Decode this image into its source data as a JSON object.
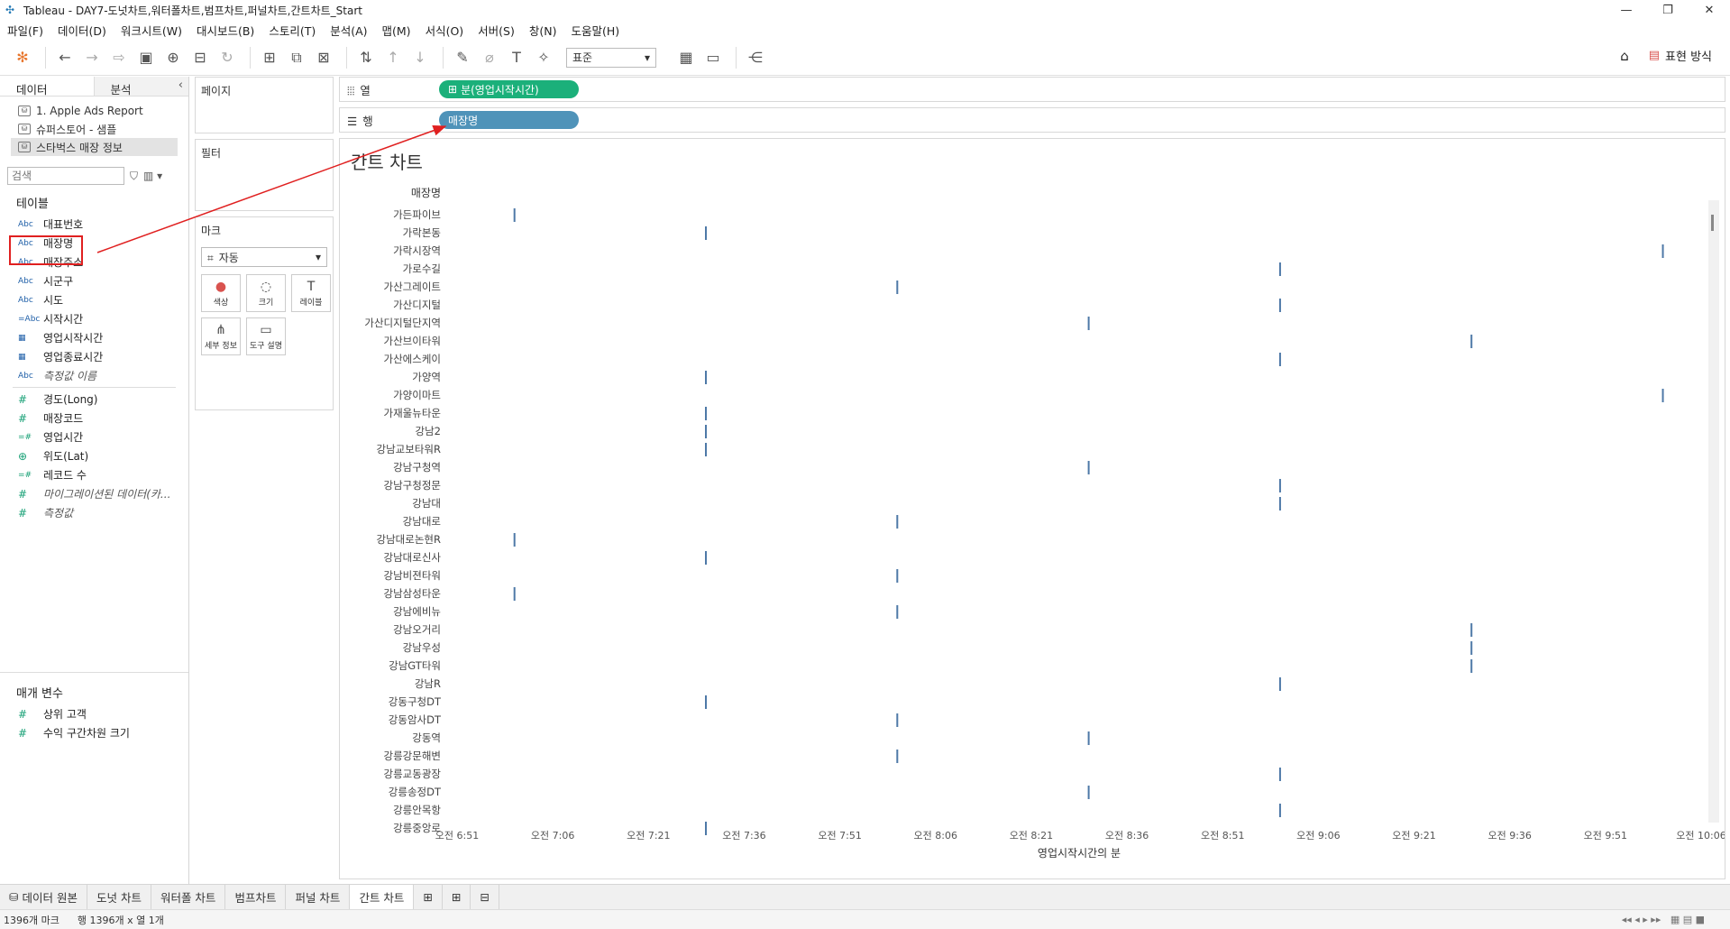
{
  "window": {
    "title": "Tableau - DAY7-도넛차트,워터폴차트,범프차트,퍼널차트,간트차트_Start"
  },
  "menu": [
    "파일(F)",
    "데이터(D)",
    "워크시트(W)",
    "대시보드(B)",
    "스토리(T)",
    "분석(A)",
    "맵(M)",
    "서식(O)",
    "서버(S)",
    "창(N)",
    "도움말(H)"
  ],
  "toolbar": {
    "fit_select": "표준",
    "show_me_label": "표현 방식"
  },
  "left_pane": {
    "tab_data": "데이터",
    "tab_analysis": "분석",
    "datasources": [
      "1. Apple Ads Report",
      "슈퍼스토어 - 샘플",
      "스타벅스 매장 정보"
    ],
    "search_placeholder": "검색",
    "tables_title": "테이블",
    "dimensions": [
      {
        "type": "Abc",
        "name": "대표번호"
      },
      {
        "type": "Abc",
        "name": "매장명"
      },
      {
        "type": "Abc",
        "name": "매장주소"
      },
      {
        "type": "Abc",
        "name": "시군구"
      },
      {
        "type": "Abc",
        "name": "시도"
      },
      {
        "type": "=Abc",
        "name": "시작시간"
      },
      {
        "type": "date",
        "name": "영업시작시간"
      },
      {
        "type": "date",
        "name": "영업종료시간"
      },
      {
        "type": "Abc",
        "name": "측정값 이름"
      }
    ],
    "measures": [
      {
        "type": "#",
        "name": "경도(Long)"
      },
      {
        "type": "#",
        "name": "매장코드"
      },
      {
        "type": "=#",
        "name": "영업시간"
      },
      {
        "type": "globe",
        "name": "위도(Lat)"
      },
      {
        "type": "=#",
        "name": "레코드 수"
      },
      {
        "type": "#",
        "name": "마이그레이션된 데이터(카..."
      },
      {
        "type": "#",
        "name": "측정값"
      }
    ],
    "params_title": "매개 변수",
    "params": [
      {
        "type": "#",
        "name": "상위 고객"
      },
      {
        "type": "#",
        "name": "수익 구간차원 크기"
      }
    ]
  },
  "cards": {
    "pages": "페이지",
    "filters": "필터",
    "marks": "마크",
    "marks_type": "자동",
    "mark_buttons": [
      {
        "icon": "color-icon",
        "label": "색상"
      },
      {
        "icon": "size-icon",
        "label": "크기"
      },
      {
        "icon": "label-icon",
        "label": "레이블"
      },
      {
        "icon": "detail-icon",
        "label": "세부 정보"
      },
      {
        "icon": "tooltip-icon",
        "label": "도구 설명"
      }
    ]
  },
  "shelves": {
    "columns_label": "열",
    "rows_label": "행",
    "columns_pill": "분(영업시작시간)",
    "rows_pill": "매장명"
  },
  "viz": {
    "title": "간트 차트"
  },
  "chart_data": {
    "type": "gantt",
    "title": "간트 차트",
    "row_header": "매장명",
    "xlabel": "영업시작시간의 분",
    "xticks": [
      "오전 6:51",
      "오전 7:06",
      "오전 7:21",
      "오전 7:36",
      "오전 7:51",
      "오전 8:06",
      "오전 8:21",
      "오전 8:36",
      "오전 8:51",
      "오전 9:06",
      "오전 9:21",
      "오전 9:36",
      "오전 9:51",
      "오전 10:06"
    ],
    "x_range_minutes": [
      411,
      606
    ],
    "stores": [
      {
        "name": "가든파이브",
        "start": "7:00"
      },
      {
        "name": "가락본동",
        "start": "7:30"
      },
      {
        "name": "가락시장역",
        "start": "10:00"
      },
      {
        "name": "가로수길",
        "start": "9:00"
      },
      {
        "name": "가산그레이트",
        "start": "8:00"
      },
      {
        "name": "가산디지털",
        "start": "9:00"
      },
      {
        "name": "가산디지털단지역",
        "start": "8:30"
      },
      {
        "name": "가산브이타워",
        "start": "9:30"
      },
      {
        "name": "가산에스케이",
        "start": "9:00"
      },
      {
        "name": "가양역",
        "start": "7:30"
      },
      {
        "name": "가양이마트",
        "start": "10:00"
      },
      {
        "name": "가재울뉴타운",
        "start": "7:30"
      },
      {
        "name": "강남2",
        "start": "7:30"
      },
      {
        "name": "강남교보타워R",
        "start": "7:30"
      },
      {
        "name": "강남구청역",
        "start": "8:30"
      },
      {
        "name": "강남구청정문",
        "start": "9:00"
      },
      {
        "name": "강남대",
        "start": "9:00"
      },
      {
        "name": "강남대로",
        "start": "8:00"
      },
      {
        "name": "강남대로논현R",
        "start": "7:00"
      },
      {
        "name": "강남대로신사",
        "start": "7:30"
      },
      {
        "name": "강남비젼타워",
        "start": "8:00"
      },
      {
        "name": "강남삼성타운",
        "start": "7:00"
      },
      {
        "name": "강남에비뉴",
        "start": "8:00"
      },
      {
        "name": "강남오거리",
        "start": "9:30"
      },
      {
        "name": "강남우성",
        "start": "9:30"
      },
      {
        "name": "강남GT타워",
        "start": "9:30"
      },
      {
        "name": "강남R",
        "start": "9:00"
      },
      {
        "name": "강동구청DT",
        "start": "7:30"
      },
      {
        "name": "강동암사DT",
        "start": "8:00"
      },
      {
        "name": "강동역",
        "start": "8:30"
      },
      {
        "name": "강릉강문해변",
        "start": "8:00"
      },
      {
        "name": "강릉교동광장",
        "start": "9:00"
      },
      {
        "name": "강릉송정DT",
        "start": "8:30"
      },
      {
        "name": "강릉안목항",
        "start": "9:00"
      },
      {
        "name": "강릉중앙로",
        "start": "7:30"
      }
    ]
  },
  "bottom_tabs": [
    "데이터 원본",
    "도넛 차트",
    "워터폴 차트",
    "범프차트",
    "퍼널 차트",
    "간트 차트"
  ],
  "active_tab": "간트 차트",
  "status": {
    "marks": "1396개 마크",
    "rows_cols": "행 1396개 x 열 1개"
  }
}
